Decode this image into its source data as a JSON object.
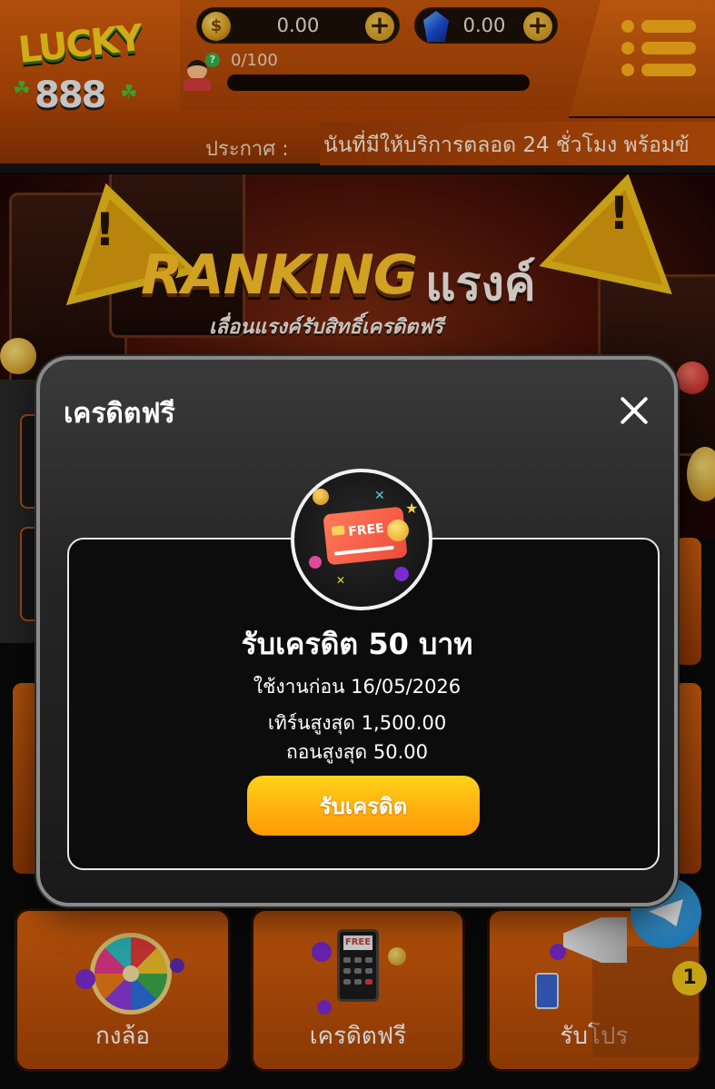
{
  "header": {
    "logo_text_top": "LUCKY",
    "logo_text_bottom": "888",
    "wallet": {
      "coin_icon": "coin-icon",
      "coin_balance": "0.00",
      "gem_icon": "gem-icon",
      "gem_balance": "0.00"
    },
    "level_progress_text": "0/100",
    "level_progress_fraction": 0,
    "menu_icon": "hamburger-menu-icon"
  },
  "announcement": {
    "label": "ประกาศ :",
    "text": "นันที่มีให้บริการตลอด 24 ชั่วโมง พร้อมข้"
  },
  "banner": {
    "title_en": "RANKING",
    "title_th": "แรงค์",
    "subtitle": "เลื่อนแรงค์รับสิทธิ์เครดิตฟรี"
  },
  "modal": {
    "title": "เครดิตฟรี",
    "close_icon": "close-icon",
    "image_icon": "free-credit-card-icon",
    "image_text": "FREE",
    "reward_title": "รับเครดิต 50 บาท",
    "use_before": "ใช้งานก่อน 16/05/2026",
    "max_turnover": "เทิร์นสูงสุด 1,500.00",
    "max_withdraw": "ถอนสูงสุด 50.00",
    "claim_button": "รับเครดิต"
  },
  "tiles": [
    {
      "label": "กงล้อ",
      "icon": "prize-wheel-icon"
    },
    {
      "label": "เครดิตฟรี",
      "icon": "free-credit-phone-icon",
      "icon_text": "FREE"
    },
    {
      "label": "รับโปร",
      "icon": "promotion-megaphone-icon"
    }
  ],
  "floating": {
    "telegram_icon": "telegram-icon",
    "promo_icon": "promotion-megaphone-icon",
    "promo_badge_count": "1"
  },
  "colors": {
    "accent_orange": "#d8610f",
    "button_yellow": "#ffb10e",
    "modal_bg": "#252525"
  }
}
